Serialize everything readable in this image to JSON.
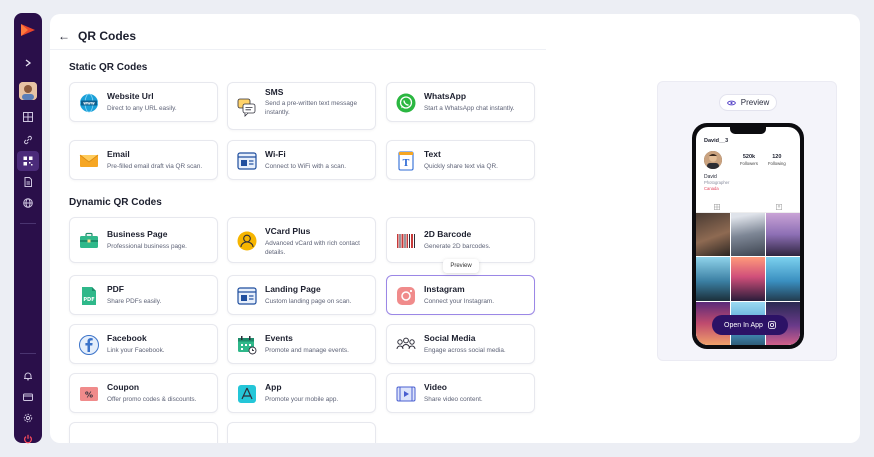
{
  "header": {
    "title": "QR Codes"
  },
  "sections": {
    "static_title": "Static QR Codes",
    "dynamic_title": "Dynamic QR Codes"
  },
  "static_cards": [
    {
      "title": "Website Url",
      "desc": "Direct to any URL easily.",
      "icon": "globe-www-icon"
    },
    {
      "title": "SMS",
      "desc": "Send a pre-written text message instantly.",
      "icon": "chat-bubbles-icon"
    },
    {
      "title": "WhatsApp",
      "desc": "Start a WhatsApp chat instantly.",
      "icon": "whatsapp-icon"
    },
    {
      "title": "Email",
      "desc": "Pre-filled email draft via QR scan.",
      "icon": "envelope-icon"
    },
    {
      "title": "Wi-Fi",
      "desc": "Connect to WiFi with a scan.",
      "icon": "wifi-window-icon"
    },
    {
      "title": "Text",
      "desc": "Quickly share text via QR.",
      "icon": "text-document-icon"
    }
  ],
  "dynamic_cards": [
    {
      "title": "Business Page",
      "desc": "Professional business page.",
      "icon": "briefcase-icon"
    },
    {
      "title": "VCard Plus",
      "desc": "Advanced vCard with rich contact details.",
      "icon": "user-circle-icon"
    },
    {
      "title": "2D Barcode",
      "desc": "Generate 2D barcodes.",
      "icon": "barcode-icon"
    },
    {
      "title": "PDF",
      "desc": "Share PDFs easily.",
      "icon": "pdf-icon"
    },
    {
      "title": "Landing Page",
      "desc": "Custom landing page on scan.",
      "icon": "landing-page-icon"
    },
    {
      "title": "Instagram",
      "desc": "Connect your Instagram.",
      "icon": "instagram-icon"
    },
    {
      "title": "Facebook",
      "desc": "Link your Facebook.",
      "icon": "facebook-icon"
    },
    {
      "title": "Events",
      "desc": "Promote and manage events.",
      "icon": "calendar-icon"
    },
    {
      "title": "Social Media",
      "desc": "Engage across social media.",
      "icon": "people-icon"
    },
    {
      "title": "Coupon",
      "desc": "Offer promo codes & discounts.",
      "icon": "coupon-icon"
    },
    {
      "title": "App",
      "desc": "Promote your mobile app.",
      "icon": "app-store-icon"
    },
    {
      "title": "Video",
      "desc": "Share video content.",
      "icon": "video-icon"
    }
  ],
  "tooltip": "Preview",
  "preview": {
    "button_label": "Preview",
    "profile": {
      "username": "David__3",
      "followers_count": "520k",
      "followers_label": "Followers",
      "following_count": "120",
      "following_label": "Following",
      "name": "David",
      "role": "Photographer",
      "location": "Canada"
    },
    "open_button": "Open In App"
  },
  "colors": {
    "sidebar_bg": "#2a0f4a",
    "accent": "#2c1266",
    "selected_border": "#9b87e6",
    "brand_red": "#e8452c"
  }
}
